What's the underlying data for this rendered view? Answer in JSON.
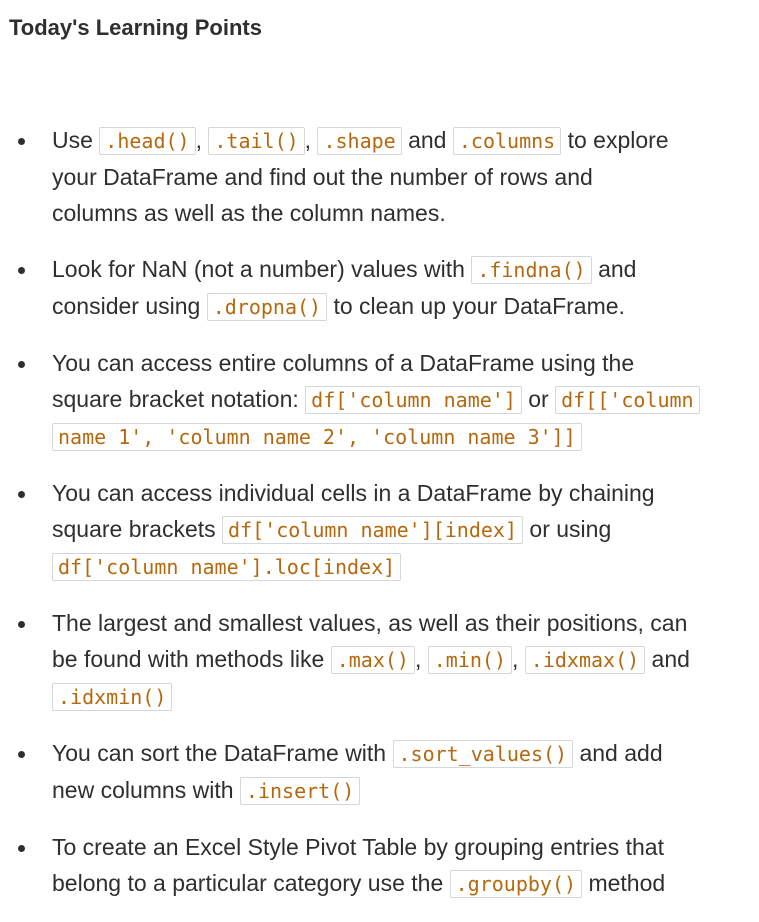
{
  "title": "Today's Learning Points",
  "points": [
    {
      "lines": [
        [
          {
            "t": "text",
            "v": "Use "
          },
          {
            "t": "code",
            "v": ".head()"
          },
          {
            "t": "text",
            "v": ", "
          },
          {
            "t": "code",
            "v": ".tail()"
          },
          {
            "t": "text",
            "v": ", "
          },
          {
            "t": "code",
            "v": ".shape"
          },
          {
            "t": "text",
            "v": " and "
          },
          {
            "t": "code",
            "v": ".columns"
          },
          {
            "t": "text",
            "v": " to explore"
          }
        ],
        [
          {
            "t": "text",
            "v": "your DataFrame and find out the number of rows and"
          }
        ],
        [
          {
            "t": "text",
            "v": "columns as well as the column names."
          }
        ]
      ]
    },
    {
      "lines": [
        [
          {
            "t": "text",
            "v": "Look for NaN (not a number) values with "
          },
          {
            "t": "code",
            "v": ".findna()"
          },
          {
            "t": "text",
            "v": " and"
          }
        ],
        [
          {
            "t": "text",
            "v": "consider using "
          },
          {
            "t": "code",
            "v": ".dropna()"
          },
          {
            "t": "text",
            "v": " to clean up your DataFrame."
          }
        ]
      ]
    },
    {
      "lines": [
        [
          {
            "t": "text",
            "v": "You can access entire columns of a DataFrame using the"
          }
        ],
        [
          {
            "t": "text",
            "v": "square bracket notation: "
          },
          {
            "t": "code",
            "v": "df['column name']"
          },
          {
            "t": "text",
            "v": " or "
          },
          {
            "t": "code",
            "v": "df[['column"
          }
        ],
        [
          {
            "t": "code",
            "v": "name 1', 'column name 2', 'column name 3']]"
          }
        ]
      ]
    },
    {
      "lines": [
        [
          {
            "t": "text",
            "v": "You can access individual cells in a DataFrame by chaining"
          }
        ],
        [
          {
            "t": "text",
            "v": "square brackets "
          },
          {
            "t": "code",
            "v": "df['column name'][index]"
          },
          {
            "t": "text",
            "v": " or using"
          }
        ],
        [
          {
            "t": "code",
            "v": "df['column name'].loc[index]"
          }
        ]
      ]
    },
    {
      "lines": [
        [
          {
            "t": "text",
            "v": "The largest and smallest values, as well as their positions, can"
          }
        ],
        [
          {
            "t": "text",
            "v": "be found with methods like "
          },
          {
            "t": "code",
            "v": ".max()"
          },
          {
            "t": "text",
            "v": ", "
          },
          {
            "t": "code",
            "v": ".min()"
          },
          {
            "t": "text",
            "v": ", "
          },
          {
            "t": "code",
            "v": ".idxmax()"
          },
          {
            "t": "text",
            "v": " and"
          }
        ],
        [
          {
            "t": "code",
            "v": ".idxmin()"
          }
        ]
      ]
    },
    {
      "lines": [
        [
          {
            "t": "text",
            "v": "You can sort the DataFrame with "
          },
          {
            "t": "code",
            "v": ".sort_values()"
          },
          {
            "t": "text",
            "v": " and add"
          }
        ],
        [
          {
            "t": "text",
            "v": "new columns with "
          },
          {
            "t": "code",
            "v": ".insert()"
          }
        ]
      ]
    },
    {
      "lines": [
        [
          {
            "t": "text",
            "v": "To create an Excel Style Pivot Table by grouping entries that"
          }
        ],
        [
          {
            "t": "text",
            "v": "belong to a particular category use the "
          },
          {
            "t": "code",
            "v": ".groupby()"
          },
          {
            "t": "text",
            "v": " method"
          }
        ]
      ]
    }
  ]
}
